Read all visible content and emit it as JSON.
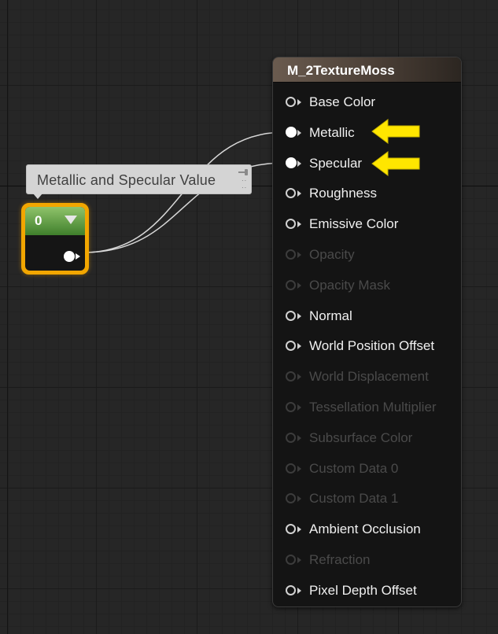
{
  "comment": {
    "text": "Metallic and Specular Value"
  },
  "constant_node": {
    "value": "0"
  },
  "material_node": {
    "title": "M_2TextureMoss",
    "pins": [
      {
        "label": "Base Color",
        "state": "hollow"
      },
      {
        "label": "Metallic",
        "state": "filled"
      },
      {
        "label": "Specular",
        "state": "filled"
      },
      {
        "label": "Roughness",
        "state": "hollow"
      },
      {
        "label": "Emissive Color",
        "state": "hollow"
      },
      {
        "label": "Opacity",
        "state": "disabled"
      },
      {
        "label": "Opacity Mask",
        "state": "disabled"
      },
      {
        "label": "Normal",
        "state": "hollow"
      },
      {
        "label": "World Position Offset",
        "state": "hollow"
      },
      {
        "label": "World Displacement",
        "state": "disabled"
      },
      {
        "label": "Tessellation Multiplier",
        "state": "disabled"
      },
      {
        "label": "Subsurface Color",
        "state": "disabled"
      },
      {
        "label": "Custom Data 0",
        "state": "disabled"
      },
      {
        "label": "Custom Data 1",
        "state": "disabled"
      },
      {
        "label": "Ambient Occlusion",
        "state": "hollow"
      },
      {
        "label": "Refraction",
        "state": "disabled"
      },
      {
        "label": "Pixel Depth Offset",
        "state": "hollow"
      }
    ]
  },
  "colors": {
    "graph_background": "#262626",
    "node_highlight": "#f2a600",
    "constant_header": "#5a9a40",
    "arrow_annotation": "#ffe600"
  }
}
